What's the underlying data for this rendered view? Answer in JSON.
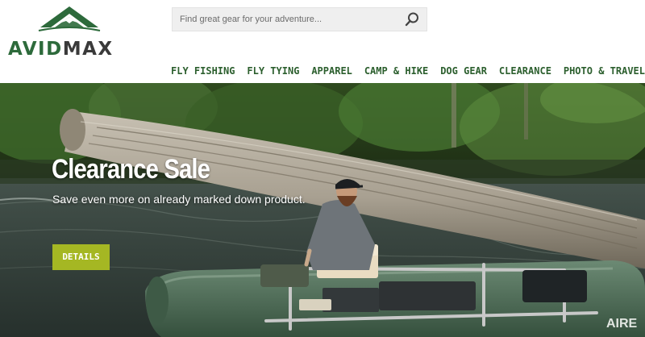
{
  "brand": {
    "name_part1": "AVID",
    "name_part2": "MAX",
    "logo_icon": "mountain-icon",
    "primary_color": "#2d6a3b",
    "secondary_color": "#3a3a3a"
  },
  "search": {
    "placeholder": "Find great gear for your adventure...",
    "value": "",
    "icon": "search-icon"
  },
  "nav": {
    "items": [
      {
        "label": "FLY FISHING"
      },
      {
        "label": "FLY TYING"
      },
      {
        "label": "APPAREL"
      },
      {
        "label": "CAMP & HIKE"
      },
      {
        "label": "DOG GEAR"
      },
      {
        "label": "CLEARANCE"
      },
      {
        "label": "PHOTO & TRAVEL"
      }
    ],
    "color": "#2c5f2e"
  },
  "hero": {
    "title": "Clearance Sale",
    "subtitle": "Save even more on already marked down product.",
    "button_label": "DETAILS",
    "button_color": "#a5b723",
    "raft_badge": "AIRE"
  }
}
